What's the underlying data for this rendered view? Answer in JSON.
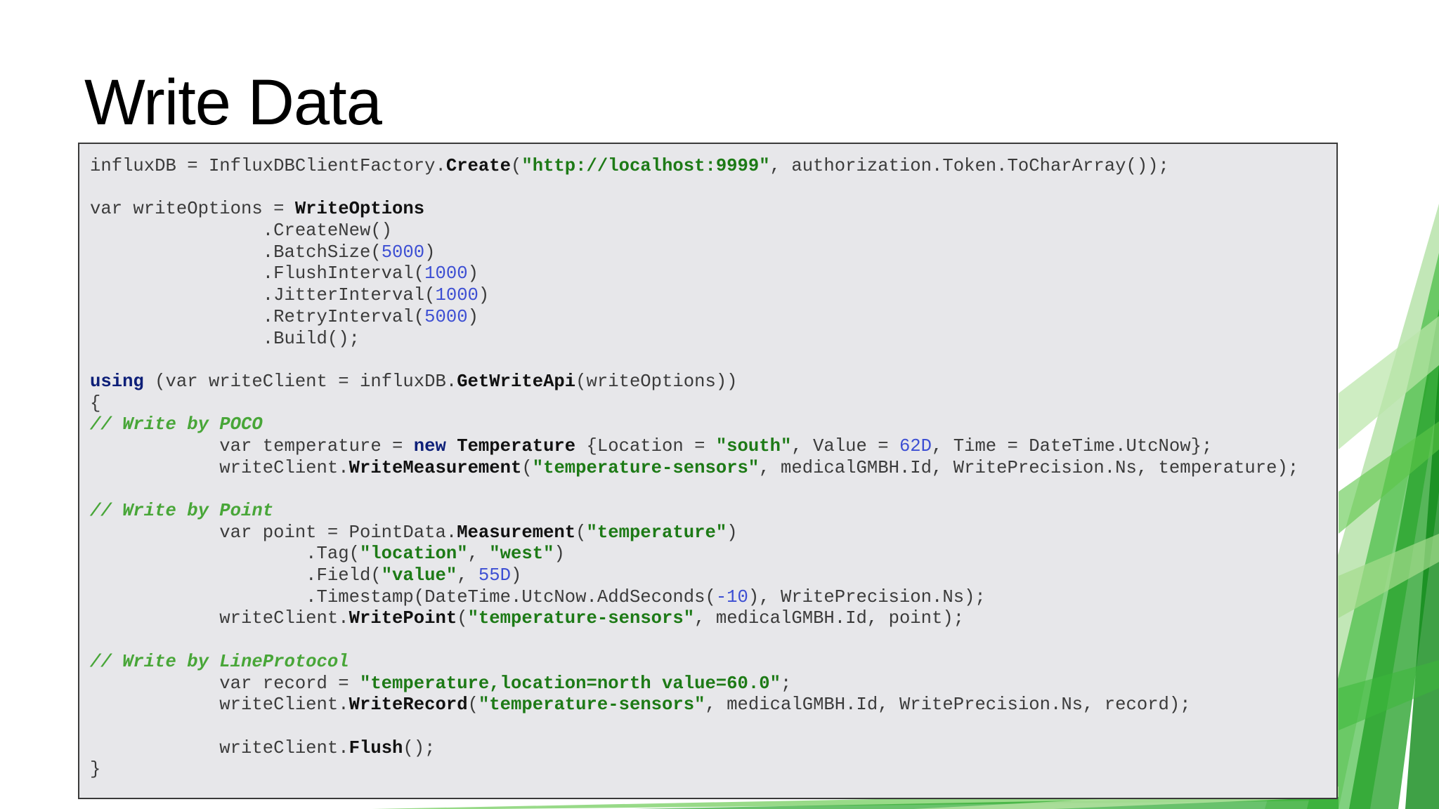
{
  "slide": {
    "title": "Write Data"
  },
  "colors": {
    "code_background": "#e7e7ea",
    "string": "#1d7a16",
    "number": "#3d4fd3",
    "keyword": "#0d1f78",
    "comment": "#48a638",
    "decoration_green": "#3cb83a"
  },
  "code_lines": [
    [
      [
        "p",
        "influxDB = InfluxDBClientFactory."
      ],
      [
        "b",
        "Create"
      ],
      [
        "p",
        "("
      ],
      [
        "s",
        "\"http://localhost:9999\""
      ],
      [
        "p",
        ", authorization.Token.ToCharArray());"
      ]
    ],
    [],
    [
      [
        "p",
        "var writeOptions = "
      ],
      [
        "b",
        "WriteOptions"
      ]
    ],
    [
      [
        "p",
        "                .CreateNew()"
      ]
    ],
    [
      [
        "p",
        "                .BatchSize("
      ],
      [
        "n",
        "5000"
      ],
      [
        "p",
        ")"
      ]
    ],
    [
      [
        "p",
        "                .FlushInterval("
      ],
      [
        "n",
        "1000"
      ],
      [
        "p",
        ")"
      ]
    ],
    [
      [
        "p",
        "                .JitterInterval("
      ],
      [
        "n",
        "1000"
      ],
      [
        "p",
        ")"
      ]
    ],
    [
      [
        "p",
        "                .RetryInterval("
      ],
      [
        "n",
        "5000"
      ],
      [
        "p",
        ")"
      ]
    ],
    [
      [
        "p",
        "                .Build();"
      ]
    ],
    [],
    [
      [
        "k",
        "using"
      ],
      [
        "p",
        " (var writeClient = influxDB."
      ],
      [
        "b",
        "GetWriteApi"
      ],
      [
        "p",
        "(writeOptions))"
      ]
    ],
    [
      [
        "p",
        "{"
      ]
    ],
    [
      [
        "c",
        "// Write by POCO"
      ]
    ],
    [
      [
        "p",
        "            var temperature = "
      ],
      [
        "k",
        "new"
      ],
      [
        "p",
        " "
      ],
      [
        "b",
        "Temperature"
      ],
      [
        "p",
        " {Location = "
      ],
      [
        "s",
        "\"south\""
      ],
      [
        "p",
        ", Value = "
      ],
      [
        "n",
        "62D"
      ],
      [
        "p",
        ", Time = DateTime.UtcNow};"
      ]
    ],
    [
      [
        "p",
        "            writeClient."
      ],
      [
        "b",
        "WriteMeasurement"
      ],
      [
        "p",
        "("
      ],
      [
        "s",
        "\"temperature-sensors\""
      ],
      [
        "p",
        ", medicalGMBH.Id, WritePrecision.Ns, temperature);"
      ]
    ],
    [],
    [
      [
        "c",
        "// Write by Point"
      ]
    ],
    [
      [
        "p",
        "            var point = PointData."
      ],
      [
        "b",
        "Measurement"
      ],
      [
        "p",
        "("
      ],
      [
        "s",
        "\"temperature\""
      ],
      [
        "p",
        ")"
      ]
    ],
    [
      [
        "p",
        "                    .Tag("
      ],
      [
        "s",
        "\"location\""
      ],
      [
        "p",
        ", "
      ],
      [
        "s",
        "\"west\""
      ],
      [
        "p",
        ")"
      ]
    ],
    [
      [
        "p",
        "                    .Field("
      ],
      [
        "s",
        "\"value\""
      ],
      [
        "p",
        ", "
      ],
      [
        "n",
        "55D"
      ],
      [
        "p",
        ")"
      ]
    ],
    [
      [
        "p",
        "                    .Timestamp(DateTime.UtcNow.AddSeconds("
      ],
      [
        "n",
        "-10"
      ],
      [
        "p",
        "), WritePrecision.Ns);"
      ]
    ],
    [
      [
        "p",
        "            writeClient."
      ],
      [
        "b",
        "WritePoint"
      ],
      [
        "p",
        "("
      ],
      [
        "s",
        "\"temperature-sensors\""
      ],
      [
        "p",
        ", medicalGMBH.Id, point);"
      ]
    ],
    [],
    [
      [
        "c",
        "// Write by LineProtocol"
      ]
    ],
    [
      [
        "p",
        "            var record = "
      ],
      [
        "s",
        "\"temperature,location=north value=60.0\""
      ],
      [
        "p",
        ";"
      ]
    ],
    [
      [
        "p",
        "            writeClient."
      ],
      [
        "b",
        "WriteRecord"
      ],
      [
        "p",
        "("
      ],
      [
        "s",
        "\"temperature-sensors\""
      ],
      [
        "p",
        ", medicalGMBH.Id, WritePrecision.Ns, record);"
      ]
    ],
    [],
    [
      [
        "p",
        "            writeClient."
      ],
      [
        "b",
        "Flush"
      ],
      [
        "p",
        "();"
      ]
    ],
    [
      [
        "p",
        "}"
      ]
    ]
  ]
}
